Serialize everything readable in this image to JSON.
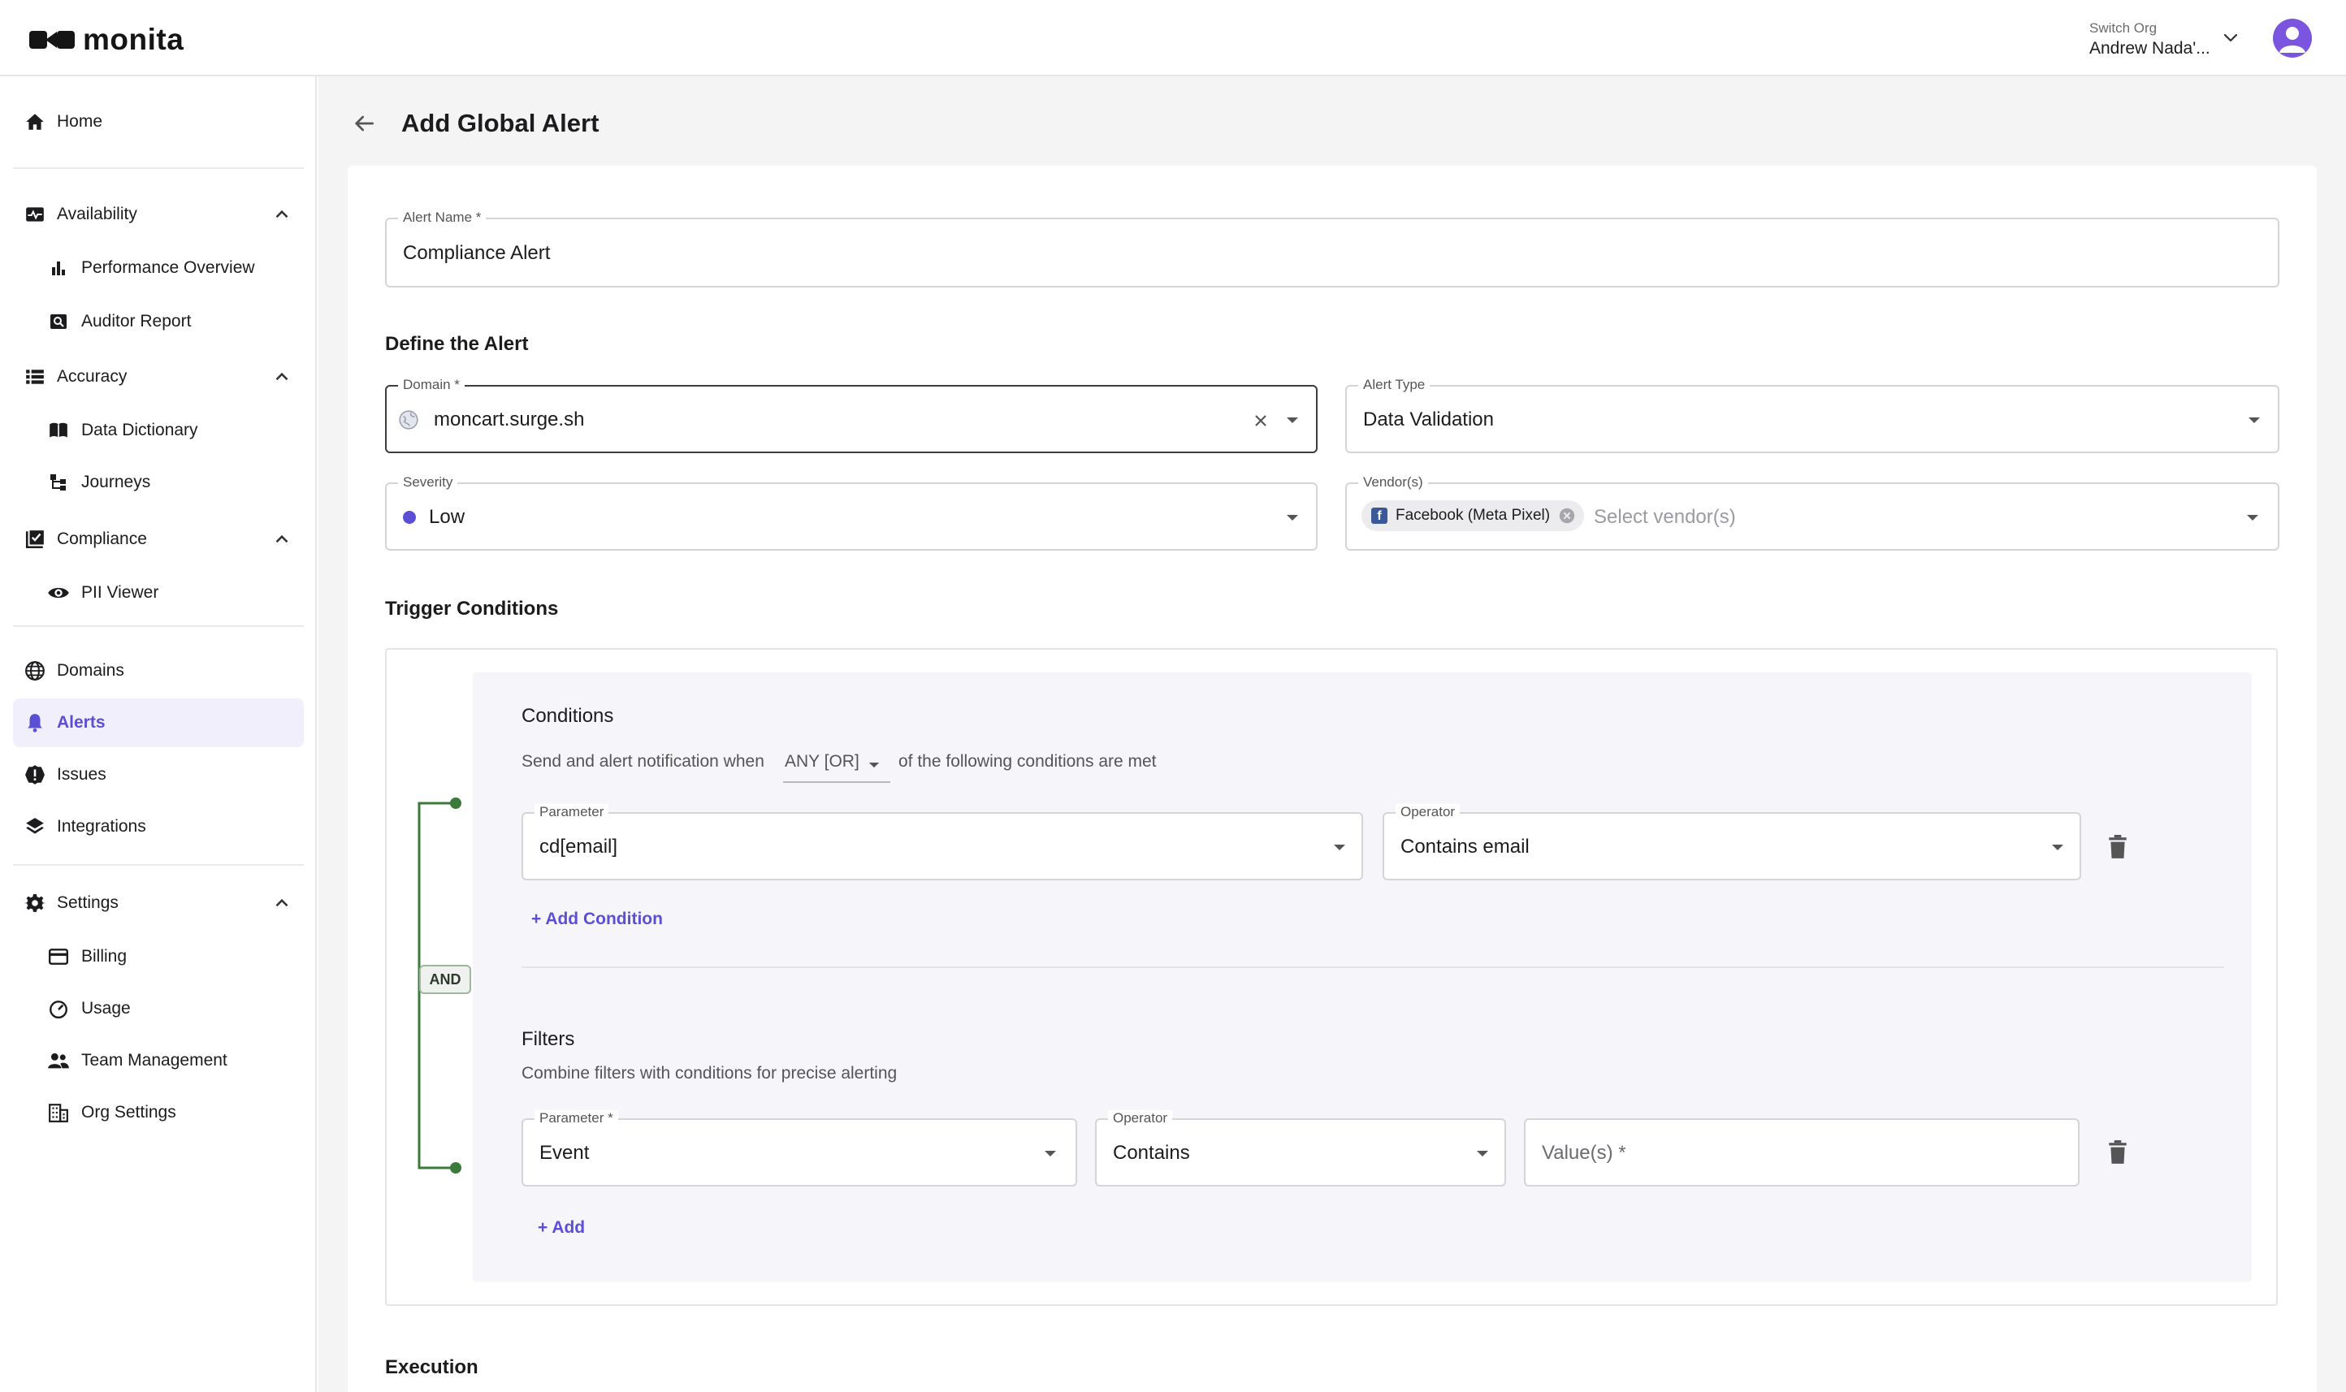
{
  "header": {
    "logo_text": "monita",
    "switch_org_label": "Switch Org",
    "org_name": "Andrew Nada'..."
  },
  "sidebar": {
    "home": "Home",
    "availability": "Availability",
    "performance_overview": "Performance Overview",
    "auditor_report": "Auditor Report",
    "accuracy": "Accuracy",
    "data_dictionary": "Data Dictionary",
    "journeys": "Journeys",
    "compliance": "Compliance",
    "pii_viewer": "PII Viewer",
    "domains": "Domains",
    "alerts": "Alerts",
    "issues": "Issues",
    "integrations": "Integrations",
    "settings": "Settings",
    "billing": "Billing",
    "usage": "Usage",
    "team_management": "Team Management",
    "org_settings": "Org Settings"
  },
  "page": {
    "title": "Add Global Alert",
    "alert_name_label": "Alert Name *",
    "alert_name_value": "Compliance Alert",
    "define_title": "Define the Alert",
    "domain_label": "Domain *",
    "domain_value": "moncart.surge.sh",
    "alert_type_label": "Alert Type",
    "alert_type_value": "Data Validation",
    "severity_label": "Severity",
    "severity_value": "Low",
    "vendors_label": "Vendor(s)",
    "vendor_chip": "Facebook (Meta Pixel)",
    "vendors_placeholder": "Select vendor(s)",
    "trigger_title": "Trigger Conditions",
    "execution_title": "Execution"
  },
  "conditions": {
    "title": "Conditions",
    "desc_prefix": "Send and alert notification when",
    "mode": "ANY [OR]",
    "desc_suffix": "of the following conditions are met",
    "param_label": "Parameter",
    "param_value": "cd[email]",
    "operator_label": "Operator",
    "operator_value": "Contains email",
    "add_condition": "+ Add Condition",
    "and_label": "AND"
  },
  "filters": {
    "title": "Filters",
    "desc": "Combine filters with conditions for precise alerting",
    "param_label": "Parameter *",
    "param_value": "Event",
    "operator_label": "Operator",
    "operator_value": "Contains",
    "values_placeholder": "Value(s) *",
    "add": "+ Add"
  },
  "colors": {
    "accent": "#5b4fd6",
    "severity_low": "#5b4fd6",
    "tree_line": "#3a7a3a",
    "avatar": "#7b55e0"
  }
}
